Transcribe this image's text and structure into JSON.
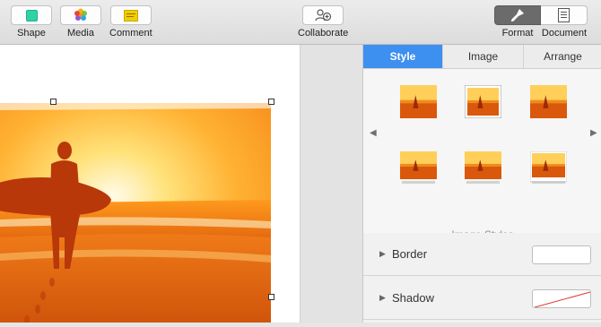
{
  "toolbar": {
    "shape_label": "Shape",
    "media_label": "Media",
    "comment_label": "Comment",
    "collaborate_label": "Collaborate",
    "format_label": "Format",
    "document_label": "Document",
    "colors": {
      "shape": "#2fd1a8",
      "comment": "#f2cd00",
      "format_bg": "#6b6b6b"
    }
  },
  "inspector": {
    "tabs": [
      {
        "label": "Style",
        "active": true
      },
      {
        "label": "Image",
        "active": false
      },
      {
        "label": "Arrange",
        "active": false
      }
    ],
    "image_styles_caption": "Image Styles",
    "rows": [
      {
        "label": "Border"
      },
      {
        "label": "Shadow"
      }
    ],
    "accent": "#3d8ff0"
  }
}
